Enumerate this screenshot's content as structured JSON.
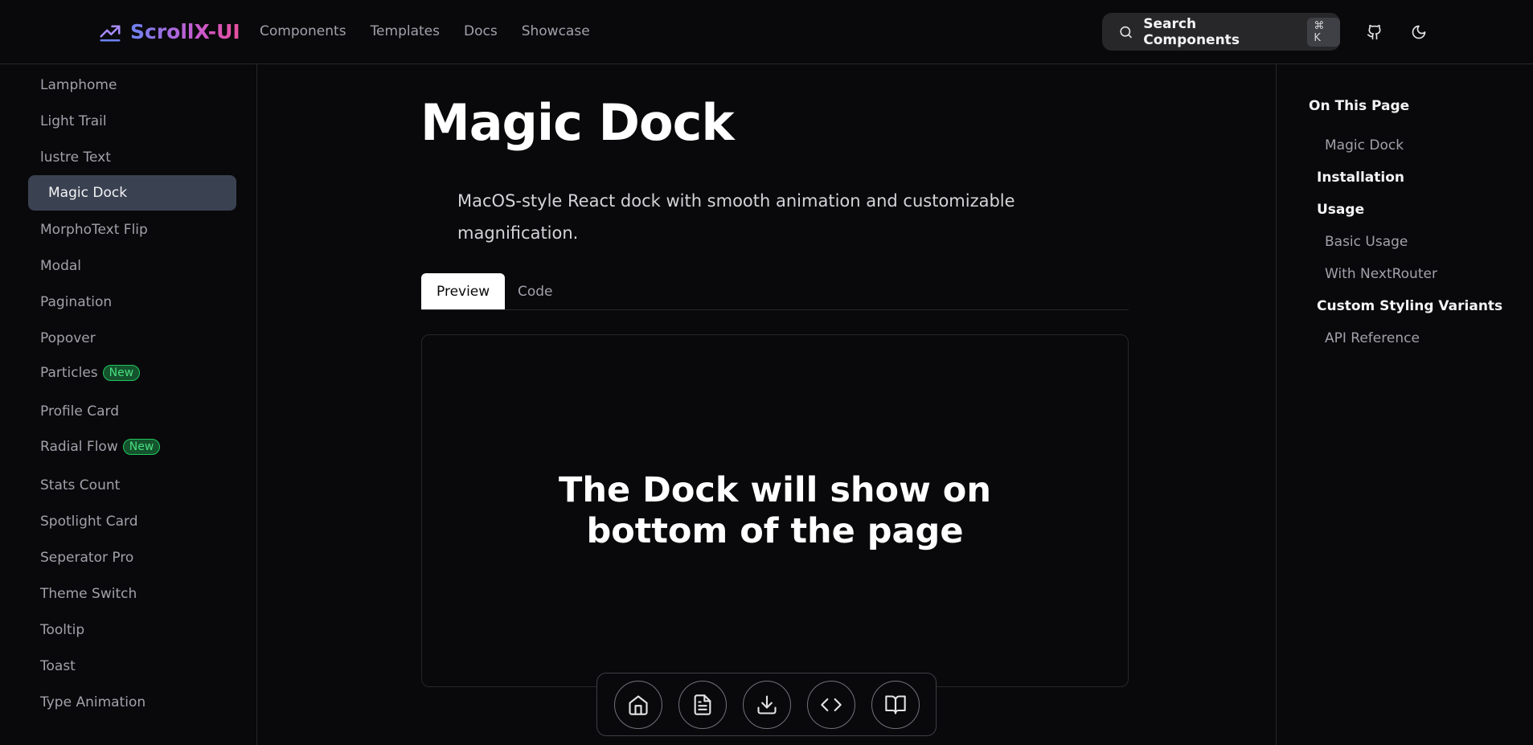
{
  "brand": {
    "name": "ScrollX-UI",
    "gradient": [
      "#6d83f2",
      "#c85ad0",
      "#e94f9c"
    ]
  },
  "nav": [
    "Components",
    "Templates",
    "Docs",
    "Showcase"
  ],
  "search": {
    "label": "Search Components",
    "shortcut": "⌘ K"
  },
  "header_icons": [
    "github-icon",
    "moon-icon"
  ],
  "sidebar": {
    "items": [
      {
        "label": "Lamphome"
      },
      {
        "label": "Light Trail"
      },
      {
        "label": "lustre Text"
      },
      {
        "label": "Magic Dock",
        "active": true
      },
      {
        "label": "MorphoText Flip"
      },
      {
        "label": "Modal"
      },
      {
        "label": "Pagination"
      },
      {
        "label": "Popover"
      },
      {
        "label": "Particles",
        "badge": "New"
      },
      {
        "label": "Profile Card"
      },
      {
        "label": "Radial Flow",
        "badge": "New"
      },
      {
        "label": "Stats Count"
      },
      {
        "label": "Spotlight Card"
      },
      {
        "label": "Seperator Pro"
      },
      {
        "label": "Theme Switch"
      },
      {
        "label": "Tooltip"
      },
      {
        "label": "Toast"
      },
      {
        "label": "Type Animation"
      }
    ]
  },
  "main": {
    "title": "Magic Dock",
    "description": "MacOS-style React dock with smooth animation and customizable magnification.",
    "tabs": [
      {
        "label": "Preview",
        "active": true
      },
      {
        "label": "Code"
      }
    ],
    "preview_text": "The Dock will show on bottom of the page",
    "dock_items": [
      "home-icon",
      "file-text-icon",
      "download-icon",
      "code-icon",
      "book-open-icon"
    ]
  },
  "toc": {
    "title": "On This Page",
    "items": [
      {
        "label": "Magic Dock",
        "level": "sub"
      },
      {
        "label": "Installation",
        "level": "main"
      },
      {
        "label": "Usage",
        "level": "main"
      },
      {
        "label": "Basic Usage",
        "level": "sub"
      },
      {
        "label": "With NextRouter",
        "level": "sub"
      },
      {
        "label": "Custom Styling Variants",
        "level": "main"
      },
      {
        "label": "API Reference",
        "level": "sub"
      }
    ]
  },
  "colors": {
    "background": "#09090b",
    "border": "#27272a",
    "active_item": "#3a4252",
    "badge_green": "#22c55e"
  }
}
